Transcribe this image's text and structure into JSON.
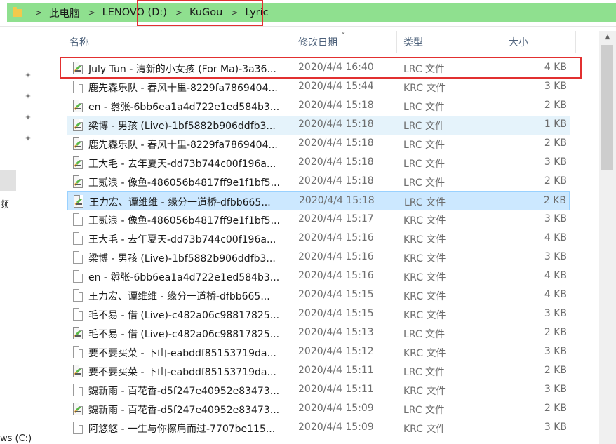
{
  "address_bar": {
    "crumbs": [
      "此电脑",
      "LENOVO (D:)",
      "KuGou",
      "Lyric"
    ]
  },
  "nav": {
    "items": [
      "频",
      "ws (C:)"
    ]
  },
  "columns": {
    "name": "名称",
    "date": "修改日期",
    "type": "类型",
    "size": "大小"
  },
  "files": [
    {
      "name": "July Tun - 清新的小女孩 (For Ma)-3a36...",
      "date": "2020/4/4 16:40",
      "type": "LRC 文件",
      "size": "4 KB",
      "icon": "lrc-edit-icon"
    },
    {
      "name": "鹿先森乐队 - 春风十里-8229fa7869404...",
      "date": "2020/4/4 15:44",
      "type": "KRC 文件",
      "size": "3 KB",
      "icon": "blank-file-icon"
    },
    {
      "name": "en - 嚣张-6bb6ea1a4d722e1ed584b3...",
      "date": "2020/4/4 15:18",
      "type": "LRC 文件",
      "size": "2 KB",
      "icon": "lrc-edit-icon"
    },
    {
      "name": "梁博 - 男孩 (Live)-1bf5882b906ddfb3...",
      "date": "2020/4/4 15:18",
      "type": "LRC 文件",
      "size": "1 KB",
      "icon": "lrc-edit-icon"
    },
    {
      "name": "鹿先森乐队 - 春风十里-8229fa7869404...",
      "date": "2020/4/4 15:18",
      "type": "LRC 文件",
      "size": "2 KB",
      "icon": "lrc-edit-icon"
    },
    {
      "name": "王大毛 - 去年夏天-dd73b744c00f196a...",
      "date": "2020/4/4 15:18",
      "type": "LRC 文件",
      "size": "3 KB",
      "icon": "lrc-edit-icon"
    },
    {
      "name": "王贰浪 - 像鱼-486056b4817ff9e1f1bf5...",
      "date": "2020/4/4 15:18",
      "type": "LRC 文件",
      "size": "2 KB",
      "icon": "lrc-edit-icon"
    },
    {
      "name": "王力宏、谭维维 - 缘分一道桥-dfbb665...",
      "date": "2020/4/4 15:18",
      "type": "LRC 文件",
      "size": "2 KB",
      "icon": "lrc-edit-icon"
    },
    {
      "name": "王贰浪 - 像鱼-486056b4817ff9e1f1bf5...",
      "date": "2020/4/4 15:17",
      "type": "KRC 文件",
      "size": "3 KB",
      "icon": "blank-file-icon"
    },
    {
      "name": "王大毛 - 去年夏天-dd73b744c00f196a...",
      "date": "2020/4/4 15:16",
      "type": "KRC 文件",
      "size": "4 KB",
      "icon": "blank-file-icon"
    },
    {
      "name": "梁博 - 男孩 (Live)-1bf5882b906ddfb3...",
      "date": "2020/4/4 15:16",
      "type": "KRC 文件",
      "size": "3 KB",
      "icon": "blank-file-icon"
    },
    {
      "name": "en - 嚣张-6bb6ea1a4d722e1ed584b3...",
      "date": "2020/4/4 15:16",
      "type": "KRC 文件",
      "size": "4 KB",
      "icon": "blank-file-icon"
    },
    {
      "name": "王力宏、谭维维 - 缘分一道桥-dfbb665...",
      "date": "2020/4/4 15:15",
      "type": "KRC 文件",
      "size": "4 KB",
      "icon": "blank-file-icon"
    },
    {
      "name": "毛不易 - 借 (Live)-c482a06c98817825...",
      "date": "2020/4/4 15:15",
      "type": "KRC 文件",
      "size": "3 KB",
      "icon": "blank-file-icon"
    },
    {
      "name": "毛不易 - 借 (Live)-c482a06c98817825...",
      "date": "2020/4/4 15:13",
      "type": "LRC 文件",
      "size": "2 KB",
      "icon": "lrc-edit-icon"
    },
    {
      "name": "要不要买菜 - 下山-eabddf85153719da...",
      "date": "2020/4/4 15:12",
      "type": "KRC 文件",
      "size": "3 KB",
      "icon": "blank-file-icon"
    },
    {
      "name": "要不要买菜 - 下山-eabddf85153719da...",
      "date": "2020/4/4 15:11",
      "type": "LRC 文件",
      "size": "2 KB",
      "icon": "lrc-edit-icon"
    },
    {
      "name": "魏新雨 - 百花香-d5f247e40952e83473...",
      "date": "2020/4/4 15:11",
      "type": "KRC 文件",
      "size": "3 KB",
      "icon": "blank-file-icon"
    },
    {
      "name": "魏新雨 - 百花香-d5f247e40952e83473...",
      "date": "2020/4/4 15:09",
      "type": "LRC 文件",
      "size": "2 KB",
      "icon": "lrc-edit-icon"
    },
    {
      "name": "阿悠悠 - 一生与你擦肩而过-7707be115...",
      "date": "2020/4/4 15:09",
      "type": "KRC 文件",
      "size": "3 KB",
      "icon": "blank-file-icon"
    }
  ],
  "colors": {
    "address_highlight": "#8fe08f",
    "annotation_red": "#e23030",
    "hover_row": "#e5f3fb",
    "selected_row": "#cce8ff"
  }
}
